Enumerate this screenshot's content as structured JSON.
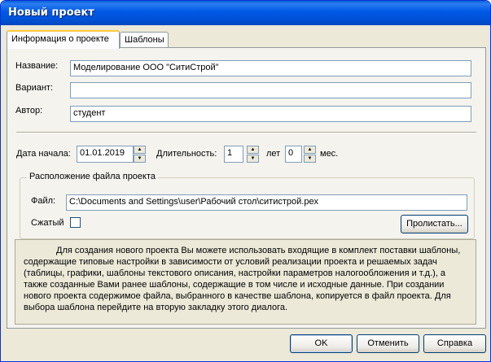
{
  "window": {
    "title": "Новый проект"
  },
  "tabs": [
    {
      "label": "Информация о проекте",
      "active": true
    },
    {
      "label": "Шаблоны",
      "active": false
    }
  ],
  "form": {
    "name_label": "Название:",
    "name_value": "Моделирование ООО \"СитиСтрой\"",
    "variant_label": "Вариант:",
    "variant_value": "",
    "author_label": "Автор:",
    "author_value": "студент",
    "start_date_label": "Дата начала:",
    "start_date_value": "01.01.2019",
    "duration_label": "Длительность:",
    "years_value": "1",
    "years_label": "лет",
    "months_value": "0",
    "months_label": "мес."
  },
  "file_group": {
    "title": "Расположение файла проекта",
    "file_label": "Файл:",
    "file_value": "C:\\Documents and Settings\\user\\Рабочий стол\\ситистрой.pex",
    "compressed_label": "Сжатый",
    "compressed_checked": false,
    "browse_label": "Пролистать..."
  },
  "description": "Для создания нового проекта Вы можете использовать входящие в комплект поставки шаблоны, содержащие типовые настройки в зависимости от условий реализации проекта и решаемых задач (таблицы, графики, шаблоны текстового описания, настройки параметров налогообложения и т.д.), а также созданные Вами ранее шаблоны, содержащие в том числе и исходные данные. При создании нового проекта содержимое файла, выбранного в качестве шаблона, копируется в файл проекта. Для выбора шаблона перейдите на вторую закладку этого диалога.",
  "buttons": {
    "ok_label": "OK",
    "cancel_label": "Отменить",
    "help_label": "Справка"
  },
  "colors": {
    "titlebar": "#0058e6",
    "dialog_bg": "#ece9d8",
    "active_tab_accent": "#ffc83c"
  }
}
